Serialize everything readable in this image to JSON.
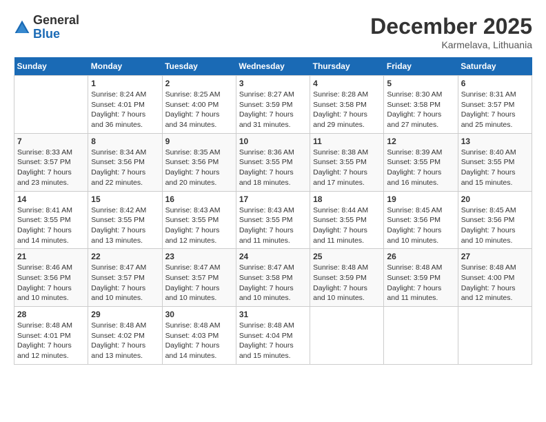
{
  "logo": {
    "general": "General",
    "blue": "Blue"
  },
  "title": "December 2025",
  "location": "Karmelava, Lithuania",
  "days_of_week": [
    "Sunday",
    "Monday",
    "Tuesday",
    "Wednesday",
    "Thursday",
    "Friday",
    "Saturday"
  ],
  "weeks": [
    [
      {
        "day": "",
        "info": ""
      },
      {
        "day": "1",
        "info": "Sunrise: 8:24 AM\nSunset: 4:01 PM\nDaylight: 7 hours\nand 36 minutes."
      },
      {
        "day": "2",
        "info": "Sunrise: 8:25 AM\nSunset: 4:00 PM\nDaylight: 7 hours\nand 34 minutes."
      },
      {
        "day": "3",
        "info": "Sunrise: 8:27 AM\nSunset: 3:59 PM\nDaylight: 7 hours\nand 31 minutes."
      },
      {
        "day": "4",
        "info": "Sunrise: 8:28 AM\nSunset: 3:58 PM\nDaylight: 7 hours\nand 29 minutes."
      },
      {
        "day": "5",
        "info": "Sunrise: 8:30 AM\nSunset: 3:58 PM\nDaylight: 7 hours\nand 27 minutes."
      },
      {
        "day": "6",
        "info": "Sunrise: 8:31 AM\nSunset: 3:57 PM\nDaylight: 7 hours\nand 25 minutes."
      }
    ],
    [
      {
        "day": "7",
        "info": "Sunrise: 8:33 AM\nSunset: 3:57 PM\nDaylight: 7 hours\nand 23 minutes."
      },
      {
        "day": "8",
        "info": "Sunrise: 8:34 AM\nSunset: 3:56 PM\nDaylight: 7 hours\nand 22 minutes."
      },
      {
        "day": "9",
        "info": "Sunrise: 8:35 AM\nSunset: 3:56 PM\nDaylight: 7 hours\nand 20 minutes."
      },
      {
        "day": "10",
        "info": "Sunrise: 8:36 AM\nSunset: 3:55 PM\nDaylight: 7 hours\nand 18 minutes."
      },
      {
        "day": "11",
        "info": "Sunrise: 8:38 AM\nSunset: 3:55 PM\nDaylight: 7 hours\nand 17 minutes."
      },
      {
        "day": "12",
        "info": "Sunrise: 8:39 AM\nSunset: 3:55 PM\nDaylight: 7 hours\nand 16 minutes."
      },
      {
        "day": "13",
        "info": "Sunrise: 8:40 AM\nSunset: 3:55 PM\nDaylight: 7 hours\nand 15 minutes."
      }
    ],
    [
      {
        "day": "14",
        "info": "Sunrise: 8:41 AM\nSunset: 3:55 PM\nDaylight: 7 hours\nand 14 minutes."
      },
      {
        "day": "15",
        "info": "Sunrise: 8:42 AM\nSunset: 3:55 PM\nDaylight: 7 hours\nand 13 minutes."
      },
      {
        "day": "16",
        "info": "Sunrise: 8:43 AM\nSunset: 3:55 PM\nDaylight: 7 hours\nand 12 minutes."
      },
      {
        "day": "17",
        "info": "Sunrise: 8:43 AM\nSunset: 3:55 PM\nDaylight: 7 hours\nand 11 minutes."
      },
      {
        "day": "18",
        "info": "Sunrise: 8:44 AM\nSunset: 3:55 PM\nDaylight: 7 hours\nand 11 minutes."
      },
      {
        "day": "19",
        "info": "Sunrise: 8:45 AM\nSunset: 3:56 PM\nDaylight: 7 hours\nand 10 minutes."
      },
      {
        "day": "20",
        "info": "Sunrise: 8:45 AM\nSunset: 3:56 PM\nDaylight: 7 hours\nand 10 minutes."
      }
    ],
    [
      {
        "day": "21",
        "info": "Sunrise: 8:46 AM\nSunset: 3:56 PM\nDaylight: 7 hours\nand 10 minutes."
      },
      {
        "day": "22",
        "info": "Sunrise: 8:47 AM\nSunset: 3:57 PM\nDaylight: 7 hours\nand 10 minutes."
      },
      {
        "day": "23",
        "info": "Sunrise: 8:47 AM\nSunset: 3:57 PM\nDaylight: 7 hours\nand 10 minutes."
      },
      {
        "day": "24",
        "info": "Sunrise: 8:47 AM\nSunset: 3:58 PM\nDaylight: 7 hours\nand 10 minutes."
      },
      {
        "day": "25",
        "info": "Sunrise: 8:48 AM\nSunset: 3:59 PM\nDaylight: 7 hours\nand 10 minutes."
      },
      {
        "day": "26",
        "info": "Sunrise: 8:48 AM\nSunset: 3:59 PM\nDaylight: 7 hours\nand 11 minutes."
      },
      {
        "day": "27",
        "info": "Sunrise: 8:48 AM\nSunset: 4:00 PM\nDaylight: 7 hours\nand 12 minutes."
      }
    ],
    [
      {
        "day": "28",
        "info": "Sunrise: 8:48 AM\nSunset: 4:01 PM\nDaylight: 7 hours\nand 12 minutes."
      },
      {
        "day": "29",
        "info": "Sunrise: 8:48 AM\nSunset: 4:02 PM\nDaylight: 7 hours\nand 13 minutes."
      },
      {
        "day": "30",
        "info": "Sunrise: 8:48 AM\nSunset: 4:03 PM\nDaylight: 7 hours\nand 14 minutes."
      },
      {
        "day": "31",
        "info": "Sunrise: 8:48 AM\nSunset: 4:04 PM\nDaylight: 7 hours\nand 15 minutes."
      },
      {
        "day": "",
        "info": ""
      },
      {
        "day": "",
        "info": ""
      },
      {
        "day": "",
        "info": ""
      }
    ]
  ]
}
